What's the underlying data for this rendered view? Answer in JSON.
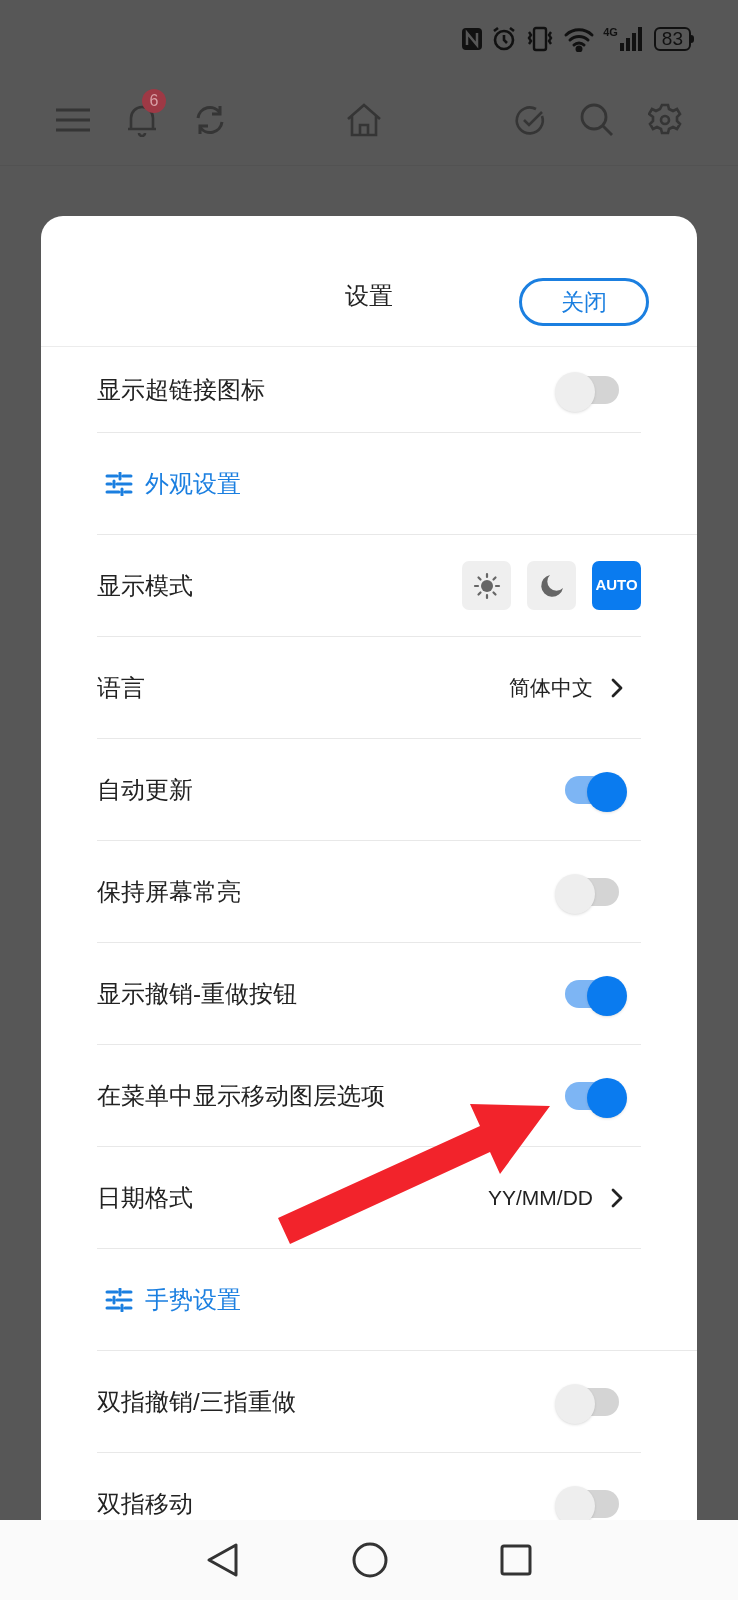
{
  "status_bar": {
    "network": "4G",
    "battery": "83"
  },
  "toolbar": {
    "notification_count": "6"
  },
  "dialog": {
    "title": "设置",
    "close_label": "关闭",
    "rows": [
      {
        "kind": "toggle",
        "label": "显示超链接图标",
        "on": false
      },
      {
        "kind": "section",
        "label": "外观设置"
      },
      {
        "kind": "modes",
        "label": "显示模式",
        "options": [
          {
            "kind": "sun",
            "selected": false
          },
          {
            "kind": "moon",
            "selected": false
          },
          {
            "kind": "auto",
            "label": "AUTO",
            "selected": true
          }
        ]
      },
      {
        "kind": "link",
        "label": "语言",
        "value": "简体中文"
      },
      {
        "kind": "toggle",
        "label": "自动更新",
        "on": true
      },
      {
        "kind": "toggle",
        "label": "保持屏幕常亮",
        "on": false
      },
      {
        "kind": "toggle",
        "label": "显示撤销-重做按钮",
        "on": true
      },
      {
        "kind": "toggle",
        "label": "在菜单中显示移动图层选项",
        "on": true
      },
      {
        "kind": "link",
        "label": "日期格式",
        "value": "YY/MM/DD"
      },
      {
        "kind": "section",
        "label": "手势设置"
      },
      {
        "kind": "toggle",
        "label": "双指撤销/三指重做",
        "on": false
      },
      {
        "kind": "toggle",
        "label": "双指移动",
        "on": false
      }
    ]
  }
}
